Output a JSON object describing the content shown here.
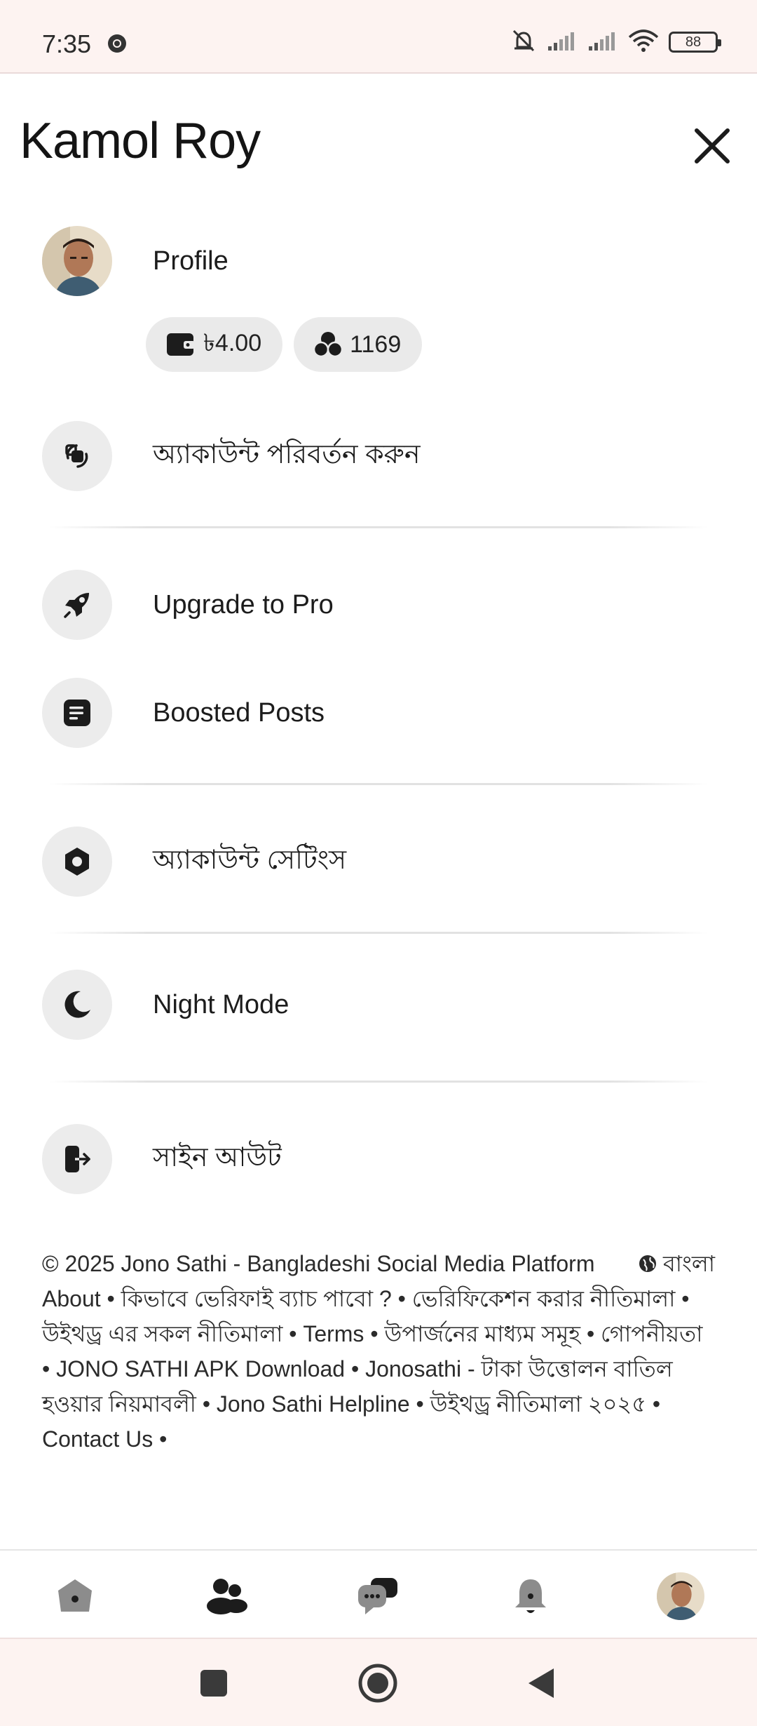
{
  "status_bar": {
    "time": "7:35",
    "battery": "88",
    "icons": [
      "chrome-icon",
      "mute-icon",
      "signal-icon",
      "signal-icon",
      "wifi-icon",
      "battery-icon"
    ]
  },
  "header": {
    "user_name": "Kamol Roy",
    "close_icon": "close-icon"
  },
  "profile": {
    "label": "Profile",
    "wallet_amount": "৳4.00",
    "points": "1169"
  },
  "menu": {
    "switch_account": "অ্যাকাউন্ট পরিবর্তন করুন",
    "upgrade": "Upgrade to Pro",
    "boosted_posts": "Boosted Posts",
    "account_settings": "অ্যাকাউন্ট সেটিংস",
    "night_mode": "Night Mode",
    "sign_out": "সাইন আউট"
  },
  "footer": {
    "copyright": "© 2025 Jono Sathi - Bangladeshi Social Media Platform",
    "language": "বাংলা",
    "links_text": "About • কিভাবে ভেরিফাই ব্যাচ পাবো ? • ভেরিফিকেশন করার নীতিমালা • উইথড্র এর সকল নীতিমালা • Terms • উপার্জনের মাধ্যম সমূহ • গোপনীয়তা • JONO SATHI APK Download • Jonosathi - টাকা উত্তোলন বাতিল হওয়ার নিয়মাবলী • Jono Sathi Helpline • উইথড্র নীতিমালা ২০২৫ • Contact Us •"
  },
  "bottom_nav": [
    "home-icon",
    "friends-icon",
    "messages-icon",
    "notifications-icon",
    "avatar"
  ],
  "colors": {
    "status_bg": "#fdf3f1",
    "circle_bg": "#ececec",
    "icon_dark": "#1c1c1c"
  }
}
